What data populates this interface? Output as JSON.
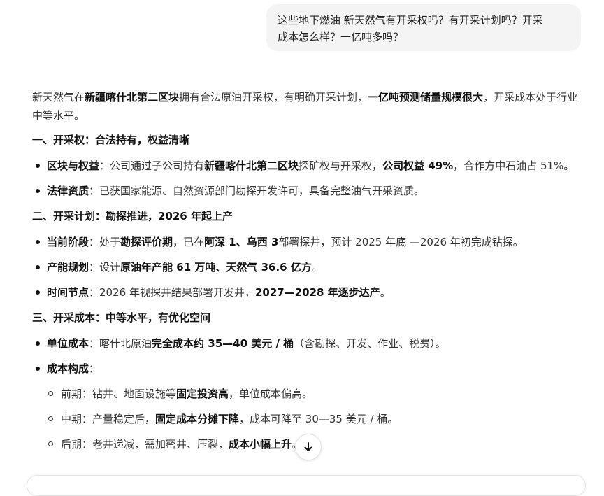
{
  "user_message": {
    "line1": "这些地下燃油 新天然气有开采权吗？有开采计划吗？开采",
    "line2": "成本怎么样？一亿吨多吗？"
  },
  "answer": {
    "intro": {
      "t1": "新天然气在",
      "b1": "新疆喀什北第二区块",
      "t2": "拥有合法原油开采权，有明确开采计划，",
      "b2": "一亿吨预测储量规模很大",
      "t3": "，开采成本处于行业中等水平。"
    },
    "section1": {
      "heading": "一、开采权：合法持有，权益清晰",
      "item1": {
        "b1": "区块与权益",
        "t1": "：公司通过子公司持有",
        "b2": "新疆喀什北第二区块",
        "t2": "探矿权与开采权，",
        "b3": "公司权益 49%",
        "t3": "，合作方中石油占 51%。"
      },
      "item2": {
        "b1": "法律资质",
        "t1": "：已获国家能源、自然资源部门勘探开发许可，具备完整油气开采资质。"
      }
    },
    "section2": {
      "heading": "二、开采计划：勘探推进，2026 年起上产",
      "item1": {
        "b1": "当前阶段",
        "t1": "：处于",
        "b2": "勘探评价期",
        "t2": "，已在",
        "b3": "阿深 1、乌西 3",
        "t3": "部署探井，预计 2025 年底 —2026 年初完成钻探。"
      },
      "item2": {
        "b1": "产能规划",
        "t1": "：设计",
        "b2": "原油年产能 61 万吨、天然气 36.6 亿方",
        "t2": "。"
      },
      "item3": {
        "b1": "时间节点",
        "t1": "：2026 年视探井结果部署开发井，",
        "b2": "2027—2028 年逐步达产",
        "t2": "。"
      }
    },
    "section3": {
      "heading": "三、开采成本：中等水平，有优化空间",
      "item1": {
        "b1": "单位成本",
        "t1": "：喀什北原油",
        "b2": "完全成本约 35—40 美元 / 桶",
        "t2": "（含勘探、开发、作业、税费）。"
      },
      "item2": {
        "b1": "成本构成",
        "t1": "：",
        "sub1": {
          "t1": "前期：钻井、地面设施等",
          "b1": "固定投资高",
          "t2": "，单位成本偏高。"
        },
        "sub2": {
          "t1": "中期：产量稳定后，",
          "b1": "固定成本分摊下降",
          "t2": "，成本可降至 30—35 美元 / 桶。"
        },
        "sub3": {
          "t1": "后期：老井递减，需加密井、压裂，",
          "b1": "成本小幅上升",
          "t2": "。"
        }
      }
    }
  },
  "scroll_button": {
    "icon": "arrow-down-icon"
  }
}
